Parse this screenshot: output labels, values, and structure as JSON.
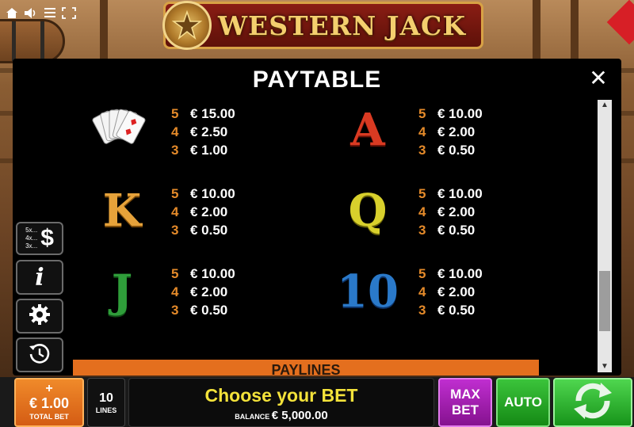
{
  "logo": {
    "title": "WESTERN JACK"
  },
  "top_icons": [
    "home-icon",
    "sound-icon",
    "menu-icon",
    "fullscreen-icon"
  ],
  "paytable": {
    "title": "PAYTABLE",
    "close_icon": "close-icon",
    "symbols": [
      {
        "symbol": "cards",
        "payouts": [
          {
            "count": "5",
            "amount": "€ 15.00"
          },
          {
            "count": "4",
            "amount": "€ 2.50"
          },
          {
            "count": "3",
            "amount": "€ 1.00"
          }
        ]
      },
      {
        "symbol": "A",
        "payouts": [
          {
            "count": "5",
            "amount": "€ 10.00"
          },
          {
            "count": "4",
            "amount": "€ 2.00"
          },
          {
            "count": "3",
            "amount": "€ 0.50"
          }
        ]
      },
      {
        "symbol": "K",
        "payouts": [
          {
            "count": "5",
            "amount": "€ 10.00"
          },
          {
            "count": "4",
            "amount": "€ 2.00"
          },
          {
            "count": "3",
            "amount": "€ 0.50"
          }
        ]
      },
      {
        "symbol": "Q",
        "payouts": [
          {
            "count": "5",
            "amount": "€ 10.00"
          },
          {
            "count": "4",
            "amount": "€ 2.00"
          },
          {
            "count": "3",
            "amount": "€ 0.50"
          }
        ]
      },
      {
        "symbol": "J",
        "payouts": [
          {
            "count": "5",
            "amount": "€ 10.00"
          },
          {
            "count": "4",
            "amount": "€ 2.00"
          },
          {
            "count": "3",
            "amount": "€ 0.50"
          }
        ]
      },
      {
        "symbol": "10",
        "payouts": [
          {
            "count": "5",
            "amount": "€ 10.00"
          },
          {
            "count": "4",
            "amount": "€ 2.00"
          },
          {
            "count": "3",
            "amount": "€ 0.50"
          }
        ]
      }
    ],
    "section_header": "PAYLINES"
  },
  "side_buttons": {
    "multipliers": {
      "lines": [
        "5x...",
        "4x...",
        "3x..."
      ],
      "symbol": "$"
    },
    "info": "i",
    "settings_icon": "gear-icon",
    "history_icon": "history-icon"
  },
  "bottom_bar": {
    "total_bet": {
      "plus": "+",
      "value": "€ 1.00",
      "label": "TOTAL BET"
    },
    "lines": {
      "value": "10",
      "label": "LINES"
    },
    "message": "Choose your BET",
    "balance": {
      "label": "BALANCE",
      "value": "€ 5,000.00"
    },
    "max_bet": {
      "line1": "MAX",
      "line2": "BET"
    },
    "auto": "AUTO",
    "spin_icon": "spin-arrows-icon"
  },
  "colors": {
    "accent_orange": "#e46f1e",
    "count_orange": "#e48a2a",
    "message_yellow": "#f3e23a",
    "max_bet_purple": "#b323c4",
    "auto_green": "#2bb52b",
    "ace_red": "#d93a22",
    "king_gold": "#e6a23a",
    "queen_yellow": "#d8d02c",
    "jack_green": "#2f9d3a",
    "ten_blue": "#2a79c9"
  }
}
